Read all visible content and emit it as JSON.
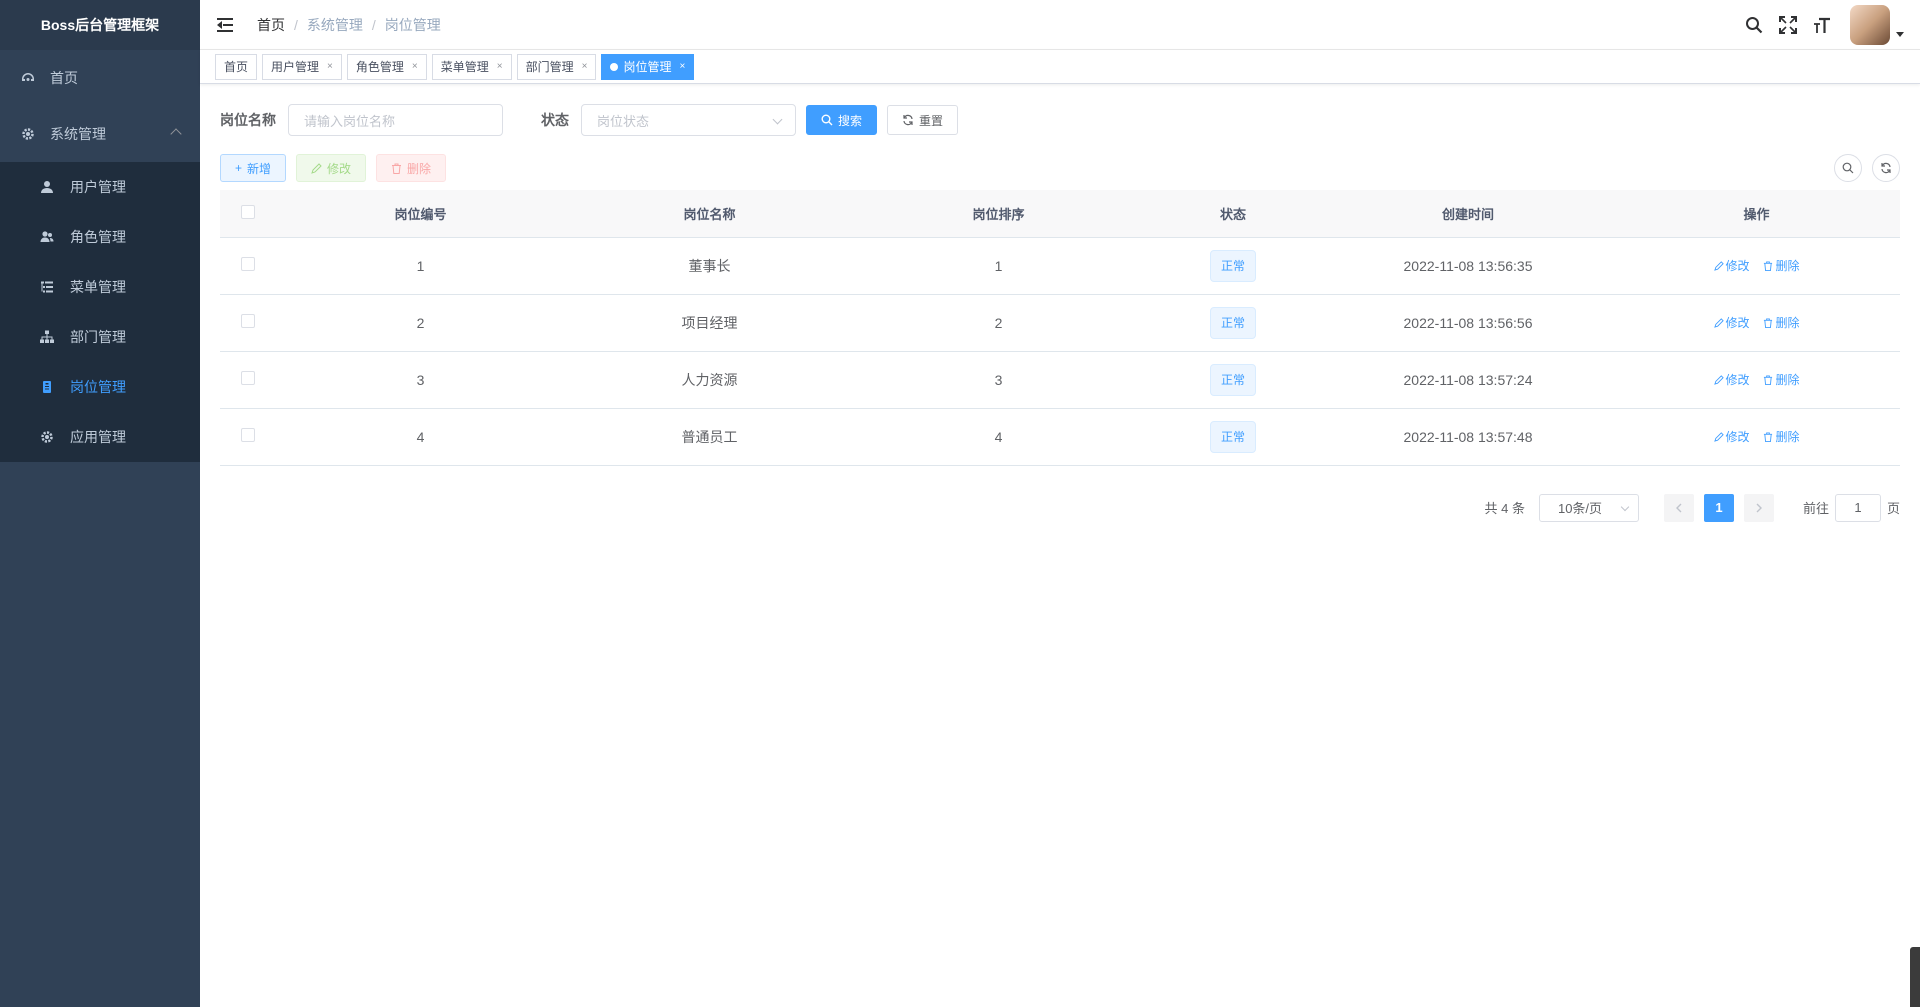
{
  "app": {
    "title": "Boss后台管理框架"
  },
  "sidebar": {
    "home": "首页",
    "system": "系统管理",
    "items": [
      {
        "label": "用户管理",
        "icon": "user-icon"
      },
      {
        "label": "角色管理",
        "icon": "peoples-icon"
      },
      {
        "label": "菜单管理",
        "icon": "tree-table-icon"
      },
      {
        "label": "部门管理",
        "icon": "tree-icon"
      },
      {
        "label": "岗位管理",
        "icon": "post-icon"
      },
      {
        "label": "应用管理",
        "icon": "gear-icon"
      }
    ],
    "bg_color": "#304156",
    "active_color": "#409eff"
  },
  "breadcrumb": [
    "首页",
    "系统管理",
    "岗位管理"
  ],
  "tags": [
    {
      "label": "首页"
    },
    {
      "label": "用户管理"
    },
    {
      "label": "角色管理"
    },
    {
      "label": "菜单管理"
    },
    {
      "label": "部门管理"
    },
    {
      "label": "岗位管理"
    }
  ],
  "search": {
    "post_name_label": "岗位名称",
    "post_name_placeholder": "请输入岗位名称",
    "status_label": "状态",
    "status_placeholder": "岗位状态",
    "search_button": "搜索",
    "reset_button": "重置"
  },
  "toolbar": {
    "add": "新增",
    "edit": "修改",
    "delete": "删除"
  },
  "table": {
    "columns": [
      "岗位编号",
      "岗位名称",
      "岗位排序",
      "状态",
      "创建时间",
      "操作"
    ],
    "rows": [
      {
        "id": "1",
        "name": "董事长",
        "sort": "1",
        "status": "正常",
        "created": "2022-11-08 13:56:35"
      },
      {
        "id": "2",
        "name": "项目经理",
        "sort": "2",
        "status": "正常",
        "created": "2022-11-08 13:56:56"
      },
      {
        "id": "3",
        "name": "人力资源",
        "sort": "3",
        "status": "正常",
        "created": "2022-11-08 13:57:24"
      },
      {
        "id": "4",
        "name": "普通员工",
        "sort": "4",
        "status": "正常",
        "created": "2022-11-08 13:57:48"
      }
    ],
    "op_edit": "修改",
    "op_delete": "删除"
  },
  "pagination": {
    "total": "共 4 条",
    "page_size": "10条/页",
    "current_page": "1",
    "goto_prefix": "前往",
    "goto_value": "1",
    "goto_suffix": "页"
  }
}
